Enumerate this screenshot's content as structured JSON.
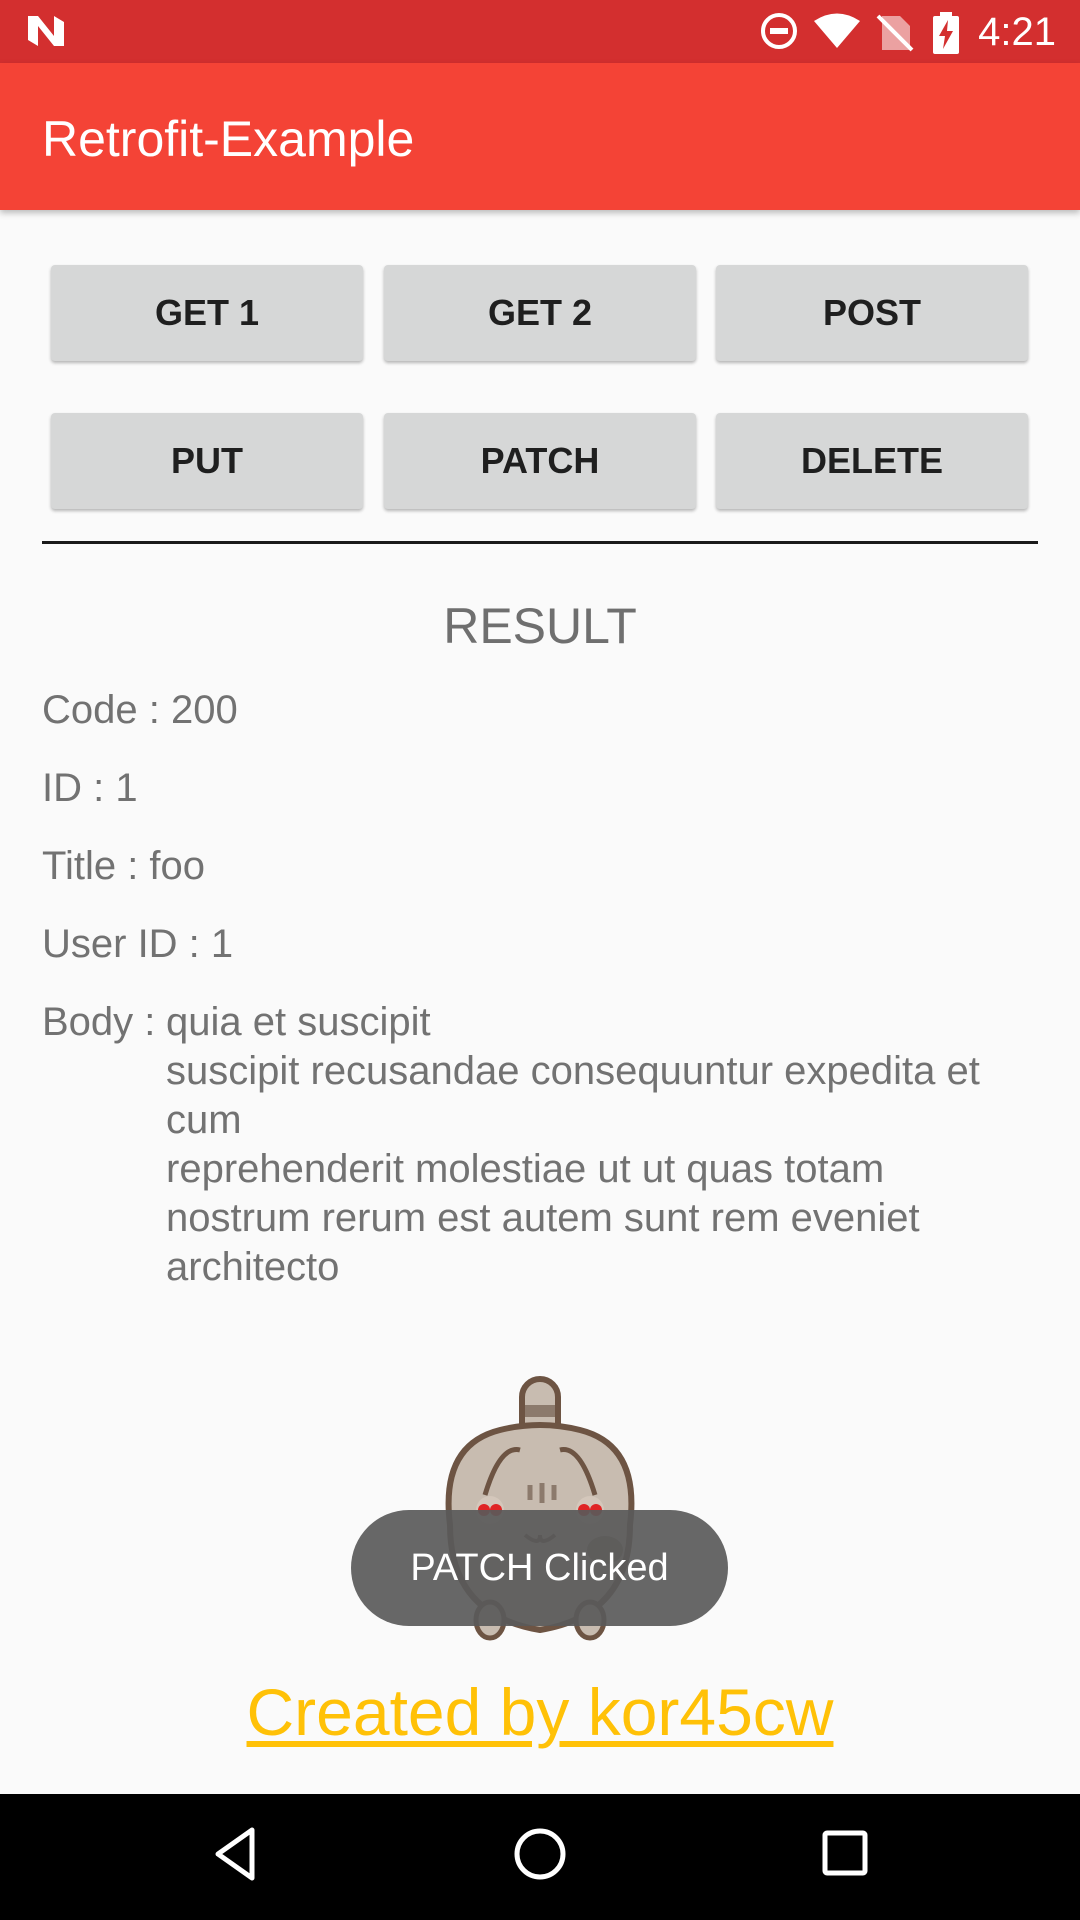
{
  "status_bar": {
    "time": "4:21",
    "color": "#d32f2f",
    "icons": [
      "android-n-logo-icon",
      "do-not-disturb-icon",
      "wifi-icon",
      "no-sim-icon",
      "battery-charging-icon"
    ]
  },
  "app_bar": {
    "title": "Retrofit-Example",
    "color": "#f44336"
  },
  "buttons": {
    "get1": "GET 1",
    "get2": "GET 2",
    "post": "POST",
    "put": "PUT",
    "patch": "PATCH",
    "delete": "DELETE"
  },
  "result": {
    "heading": "RESULT",
    "code": "Code : 200",
    "id": "ID : 1",
    "title": "Title : foo",
    "user_id": "User ID : 1",
    "body_label": "Body :",
    "body_value": "quia et suscipit\nsuscipit recusandae consequuntur expedita et cum\nreprehenderit molestiae ut ut quas totam\nnostrum rerum est autem sunt rem eveniet architecto"
  },
  "mascot": {
    "icon": "cat-mascot-image"
  },
  "toast": {
    "text": "PATCH Clicked"
  },
  "footer": {
    "credit": "Created by kor45cw",
    "link_color": "#ffc107"
  },
  "nav_bar": {
    "icons": [
      "back-icon",
      "home-icon",
      "recents-icon"
    ]
  }
}
